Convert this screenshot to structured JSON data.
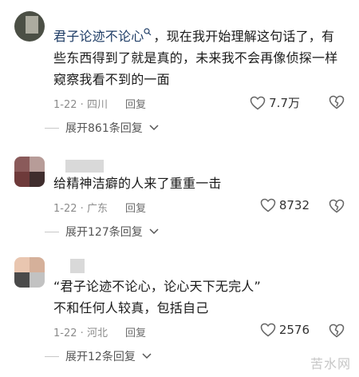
{
  "comments": [
    {
      "name": "君子论迹不论心",
      "text": "，现在我开始理解这句话了，有些东西得到了就是真的，未来我不会再像侦探一样窥察我看不到的一面",
      "date": "1-22",
      "location": "四川",
      "reply": "回复",
      "likes": "7.7万",
      "expand": "展开861条回复"
    },
    {
      "text": "给精神洁癖的人来了重重一击",
      "date": "1-22",
      "location": "广东",
      "reply": "回复",
      "likes": "8732",
      "expand": "展开127条回复"
    },
    {
      "text_line1": "“君子论迹不论心，论心天下无完人”",
      "text_line2": "不和任何人较真，包括自己",
      "date": "1-22",
      "location": "河北",
      "reply": "回复",
      "likes": "2576",
      "expand": "展开12条回复"
    }
  ],
  "watermark": "苦水网",
  "sep": "·",
  "colors": {
    "link": "#1f3d66",
    "meta": "#8c8c8c"
  }
}
